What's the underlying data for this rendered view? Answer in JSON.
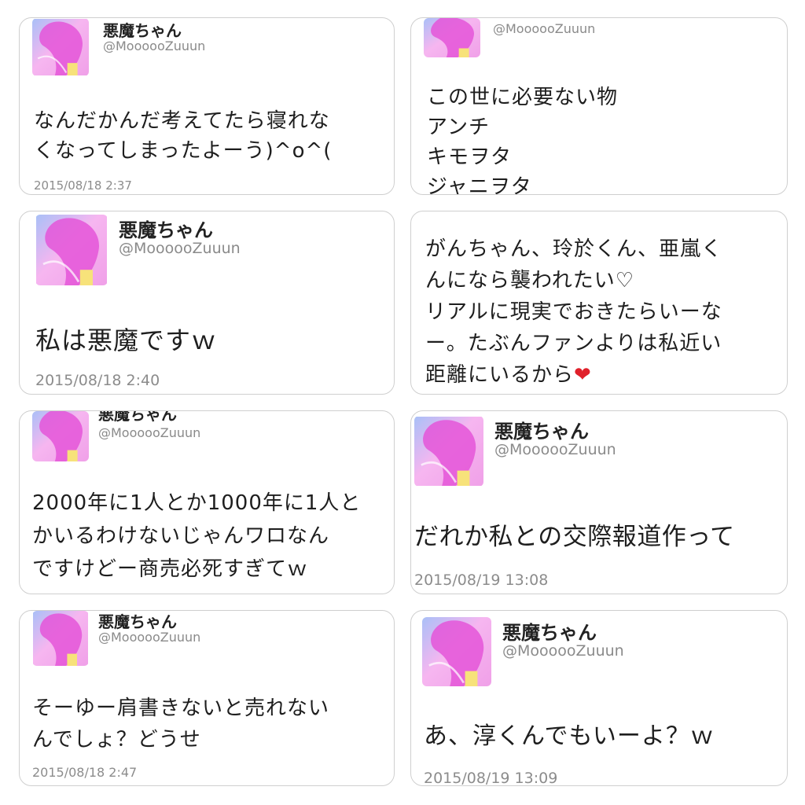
{
  "avatar_icon": "anime-girl-pink-hair-avatar",
  "colors": {
    "avatar_pink": "#f2a6ec",
    "avatar_hair": "#e14fd6",
    "avatar_blue": "#9fb8f5",
    "heart": "#e0202a"
  },
  "tweets": [
    {
      "name": "悪魔ちゃん",
      "handle": "@MoooooZuuun",
      "text": "なんだかんだ考えてたら寝れな\nくなってしまったよーう)^o^(",
      "time": "2015/08/18 2:37"
    },
    {
      "name": "",
      "handle": "@MoooooZuuun",
      "text": "この世に必要ない物\nアンチ\nキモヲタ\nジャニヲタ",
      "time": ""
    },
    {
      "name": "悪魔ちゃん",
      "handle": "@MoooooZuuun",
      "text": "私は悪魔ですｗ",
      "time": "2015/08/18 2:40"
    },
    {
      "name": "",
      "handle": "",
      "text": "がんちゃん、玲於くん、亜嵐く\nんになら襲われたい♡\nリアルに現実でおきたらいーな\nー。たぶんファンよりは私近い\n距離にいるから",
      "emoji": "❤",
      "time": ""
    },
    {
      "name": "悪魔ちゃん",
      "handle": "@MoooooZuuun",
      "text": "2000年に1人とか1000年に1人と\nかいるわけないじゃんワロなん\nですけどー商売必死すぎてｗ",
      "time": ""
    },
    {
      "name": "悪魔ちゃん",
      "handle": "@MoooooZuuun",
      "text": "だれか私との交際報道作って",
      "time": "2015/08/19 13:08"
    },
    {
      "name": "悪魔ちゃん",
      "handle": "@MoooooZuuun",
      "text": "そーゆー肩書きないと売れない\nんでしょ？どうせ",
      "time": "2015/08/18 2:47"
    },
    {
      "name": "悪魔ちゃん",
      "handle": "@MoooooZuuun",
      "text": "あ、淳くんでもいーよ？ｗ",
      "time": "2015/08/19 13:09"
    }
  ]
}
